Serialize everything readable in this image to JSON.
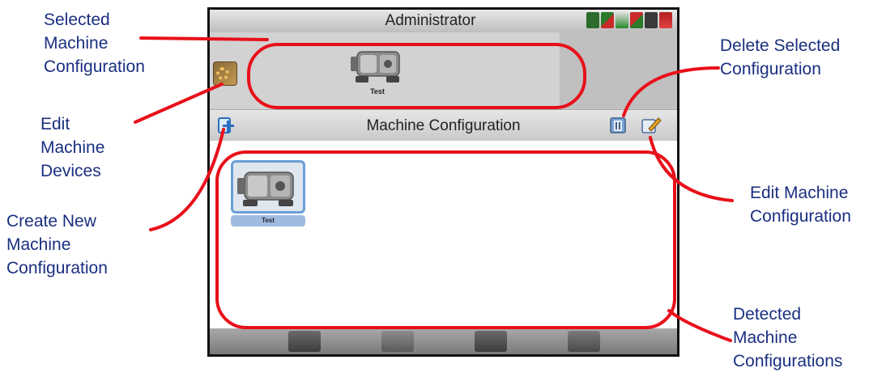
{
  "header": {
    "title": "Administrator",
    "status_icons": [
      "gps-status-icon",
      "signal-icon",
      "guidance-icon",
      "machine-icon",
      "record-icon",
      "alarm-icon"
    ]
  },
  "selected_machine": {
    "label": "Test",
    "icon": "machine-icon"
  },
  "config_panel": {
    "title": "Machine Configuration",
    "items": [
      {
        "label": "Test",
        "icon": "machine-icon"
      }
    ]
  },
  "bottom_tabs": [
    "ut-icon",
    "field-icon",
    "camera-icon",
    "audio-icon"
  ],
  "callouts": {
    "selected": "Selected\nMachine\nConfiguration",
    "edit_devices": "Edit\nMachine\nDevices",
    "create_new": "Create New\nMachine\nConfiguration",
    "delete_selected": "Delete Selected\nConfiguration",
    "edit_config": "Edit Machine\nConfiguration",
    "detected": "Detected\nMachine\nConfigurations"
  },
  "colors": {
    "callout_text": "#1a2f80",
    "annotation_red": "#e8101a",
    "selection_blue": "#6a9ed8"
  }
}
